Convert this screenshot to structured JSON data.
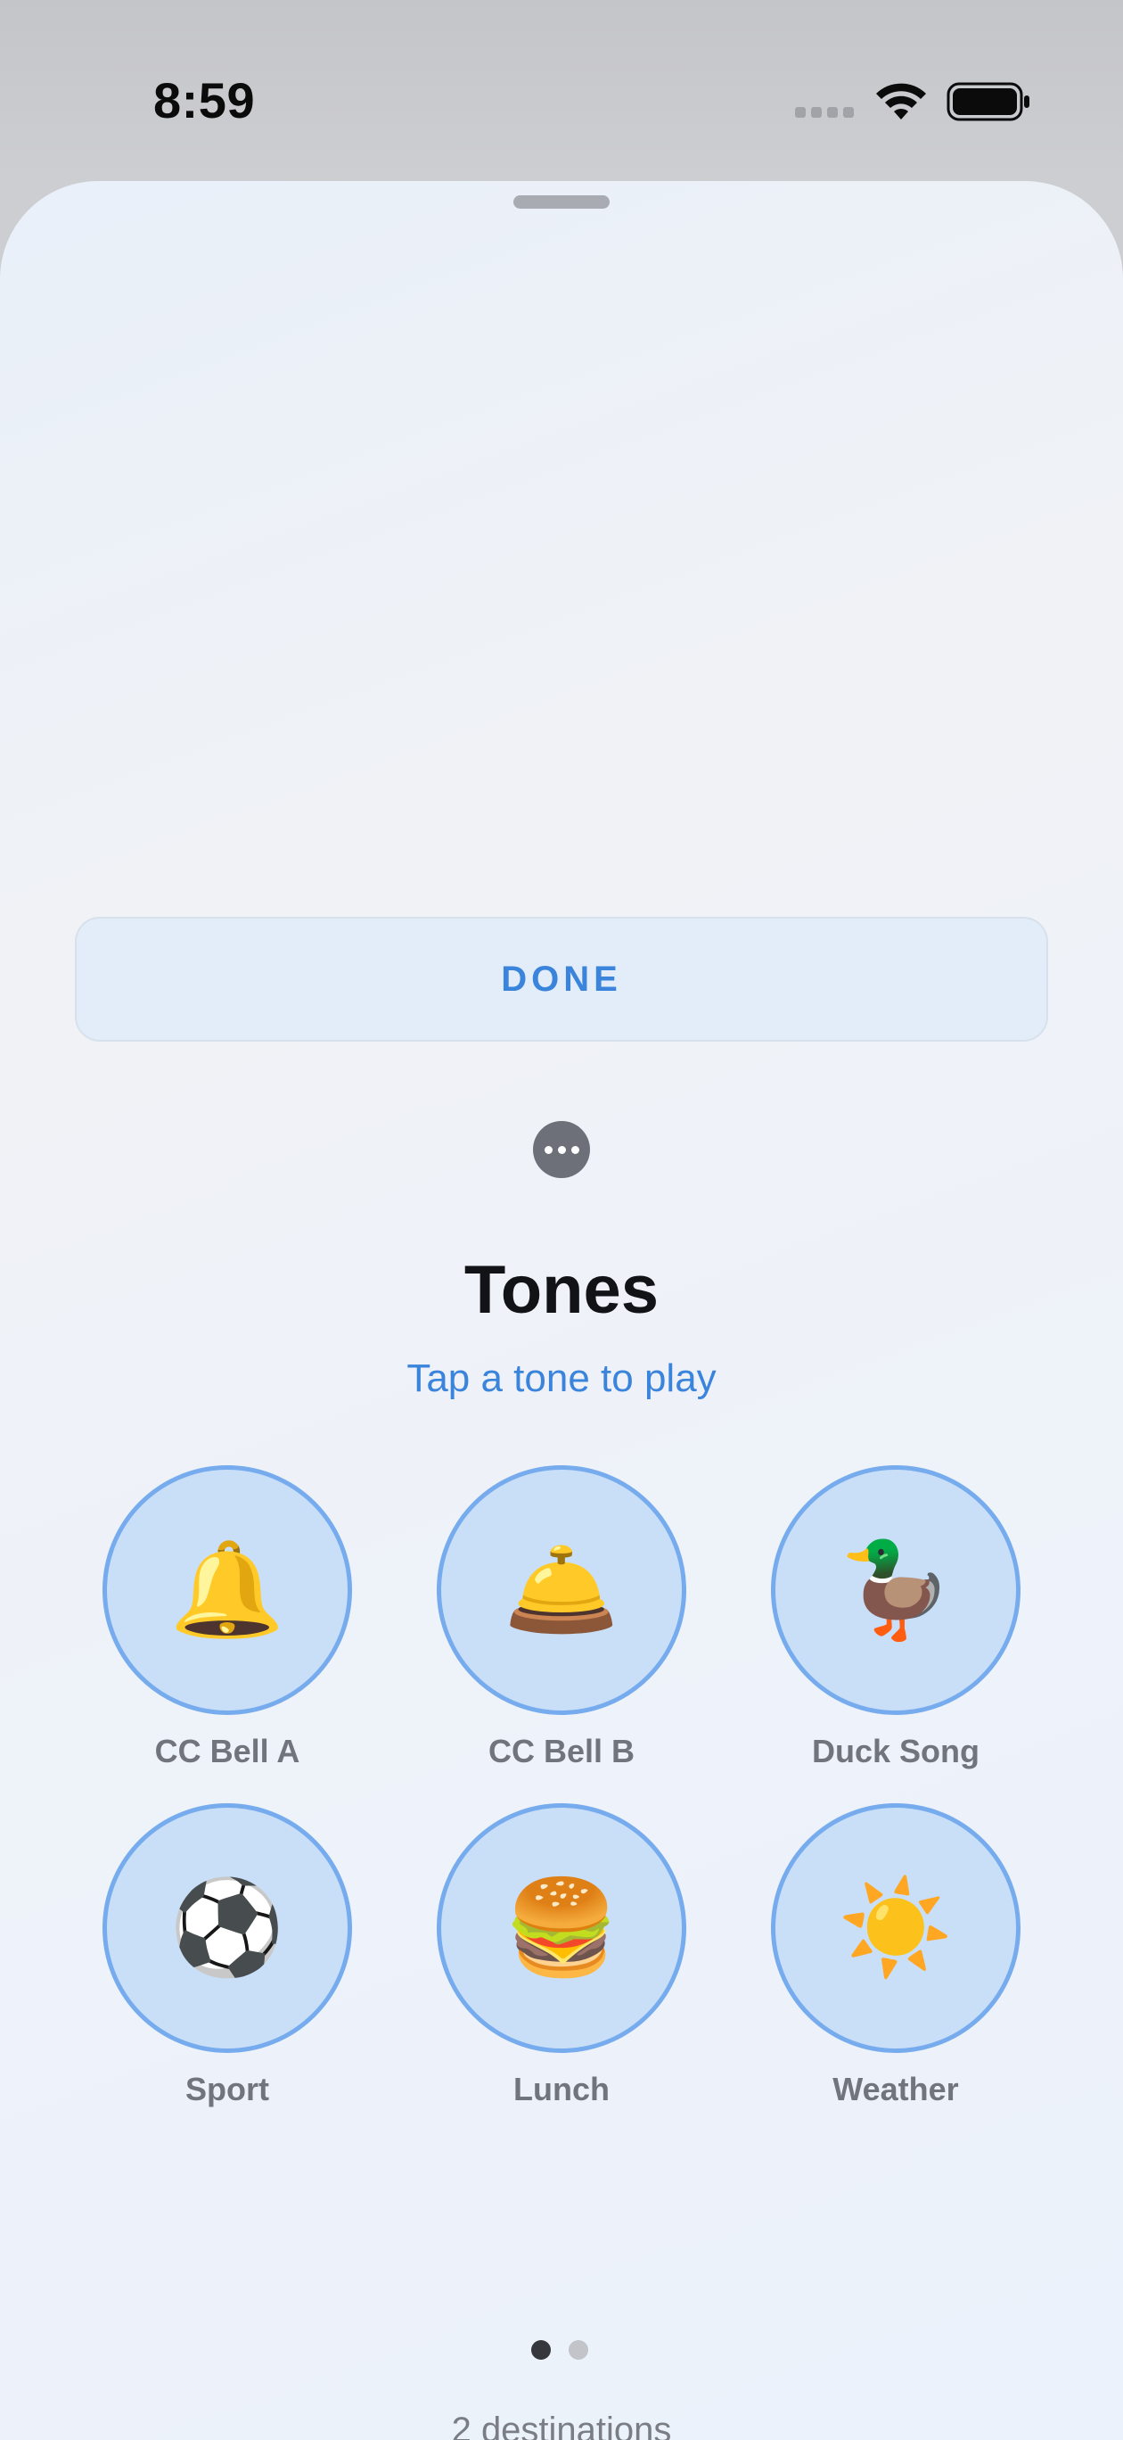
{
  "status_bar": {
    "time": "8:59",
    "icons": [
      "cellular-signal-icon",
      "wifi-icon",
      "battery-icon"
    ]
  },
  "sheet": {
    "done_label": "DONE",
    "more_icon": "ellipsis-icon",
    "title": "Tones",
    "subtitle": "Tap a tone to play",
    "tones": [
      {
        "label": "CC Bell A",
        "emoji": "🔔",
        "icon": "bell-icon"
      },
      {
        "label": "CC Bell B",
        "emoji": "🛎️",
        "icon": "service-bell-icon"
      },
      {
        "label": "Duck Song",
        "emoji": "🦆",
        "icon": "duck-icon"
      },
      {
        "label": "Sport",
        "emoji": "⚽",
        "icon": "soccer-ball-icon"
      },
      {
        "label": "Lunch",
        "emoji": "🍔",
        "icon": "burger-icon"
      },
      {
        "label": "Weather",
        "emoji": "☀️",
        "icon": "sun-icon"
      }
    ],
    "pagination": {
      "current_page": 1,
      "total_pages": 2
    },
    "footer": "2 destinations"
  },
  "colors": {
    "accent": "#3a84dc",
    "circle_fill": "#c9dff8",
    "circle_border": "#76abee",
    "text_primary": "#121316",
    "text_secondary": "#71747c"
  }
}
